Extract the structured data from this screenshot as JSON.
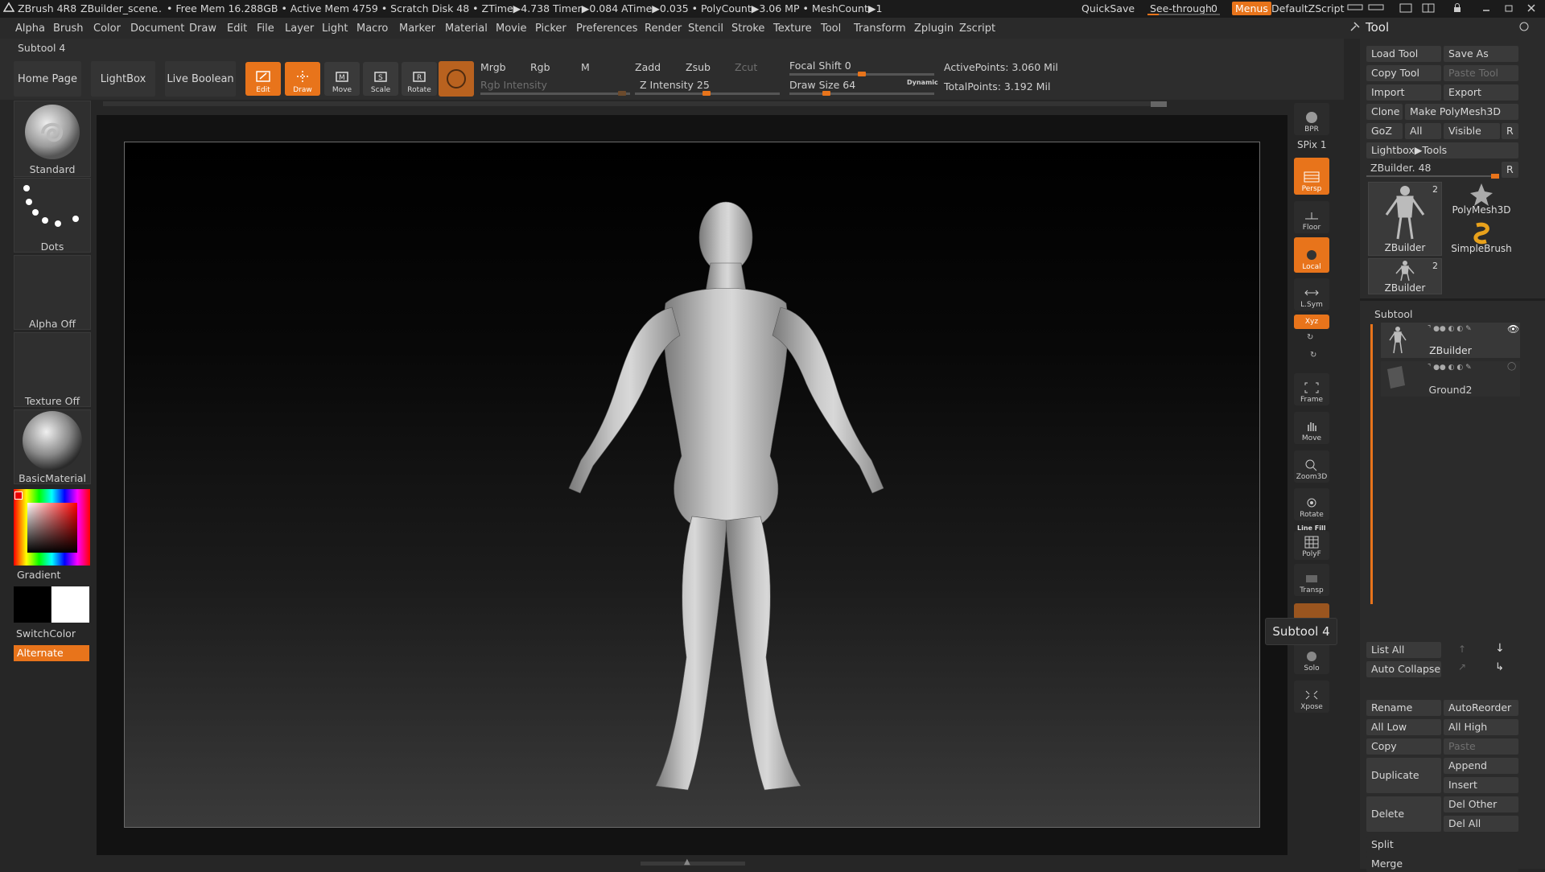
{
  "titlebar": {
    "app_name": "ZBrush 4R8",
    "scene": "ZBuilder_scene",
    "stats": "• Free Mem 16.288GB • Active Mem 4759 • Scratch Disk 48 • ZTime▶4.738 Timer▶0.084 ATime▶0.035 • PolyCount▶3.06 MP • MeshCount▶1",
    "dots": "..",
    "quicksave": "QuickSave",
    "see_through_label": "See-through",
    "see_through_value": "0",
    "menus": "Menus",
    "script": "DefaultZScript"
  },
  "menubar": {
    "items": [
      "Alpha",
      "Brush",
      "Color",
      "Document",
      "Draw",
      "Edit",
      "File",
      "Layer",
      "Light",
      "Macro",
      "Marker",
      "Material",
      "Movie",
      "Picker",
      "Preferences",
      "Render",
      "Stencil",
      "Stroke",
      "Texture",
      "Tool",
      "Transform",
      "Zplugin",
      "Zscript"
    ]
  },
  "shelf": {
    "subtool_title": "Subtool 4",
    "home_page": "Home Page",
    "lightbox": "LightBox",
    "live_boolean": "Live Boolean",
    "tools": [
      "Edit",
      "Draw",
      "Move",
      "Scale",
      "Rotate"
    ],
    "mrgb": "Mrgb",
    "rgb": "Rgb",
    "m": "M",
    "zadd": "Zadd",
    "zsub": "Zsub",
    "zcut": "Zcut",
    "rgb_intensity": "Rgb Intensity",
    "z_intensity": "Z Intensity 25",
    "z_intensity_value": 25,
    "focal_shift": "Focal Shift 0",
    "focal_shift_value": 0,
    "draw_size": "Draw Size 64",
    "draw_size_value": 64,
    "dynamic": "Dynamic",
    "active_points": "ActivePoints: 3.060 Mil",
    "total_points": "TotalPoints: 3.192 Mil"
  },
  "left_tray": {
    "brush": "Standard",
    "stroke": "Dots",
    "alpha": "Alpha Off",
    "texture": "Texture Off",
    "material": "BasicMaterial",
    "gradient": "Gradient",
    "switch_color": "SwitchColor",
    "alternate": "Alternate"
  },
  "right_shelf": {
    "bpr": "BPR",
    "spix": "SPix 1",
    "persp": "Persp",
    "dynamic": "Dynamic",
    "floor": "Floor",
    "local": "Local",
    "lsym": "L.Sym",
    "xyz": "Xyz",
    "frame": "Frame",
    "move": "Move",
    "zoom3d": "Zoom3D",
    "rotate": "Rotate",
    "line_fill": "Line Fill",
    "polyf": "PolyF",
    "transp": "Transp",
    "solo": "Solo",
    "xpose": "Xpose"
  },
  "tooltip": "Subtool 4",
  "tool_panel": {
    "title": "Tool",
    "load_tool": "Load Tool",
    "save_as": "Save As",
    "copy_tool": "Copy Tool",
    "paste_tool": "Paste Tool",
    "import": "Import",
    "export": "Export",
    "clone": "Clone",
    "make_polymesh": "Make PolyMesh3D",
    "goz": "GoZ",
    "all": "All",
    "visible": "Visible",
    "r": "R",
    "lightbox_tools": "Lightbox▶Tools",
    "zbuilder_slider": "ZBuilder. 48",
    "thumbs": [
      {
        "label": "ZBuilder",
        "count": "2"
      },
      {
        "label": "PolyMesh3D"
      },
      {
        "label": "SimpleBrush"
      },
      {
        "label": "ZBuilder",
        "count": "2"
      }
    ],
    "subtool_header": "Subtool",
    "subtools": [
      "ZBuilder",
      "Ground2"
    ],
    "list_all": "List All",
    "auto_collapse": "Auto Collapse",
    "rename": "Rename",
    "auto_reorder": "AutoReorder",
    "all_low": "All Low",
    "all_high": "All High",
    "copy": "Copy",
    "paste": "Paste",
    "duplicate": "Duplicate",
    "append": "Append",
    "insert": "Insert",
    "delete": "Delete",
    "del_other": "Del Other",
    "del_all": "Del All",
    "split": "Split",
    "merge": "Merge"
  },
  "colors": {
    "accent": "#e8741b",
    "background": "#262626",
    "panel": "#2b2b2b"
  }
}
